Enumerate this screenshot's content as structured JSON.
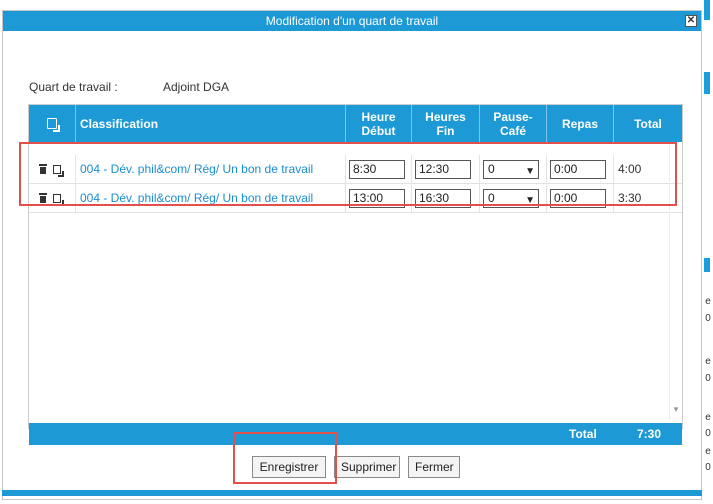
{
  "dialog": {
    "title": "Modification d'un quart de travail",
    "close_symbol": "✕"
  },
  "shift": {
    "label": "Quart de travail :",
    "value": "Adjoint DGA"
  },
  "table": {
    "headers": {
      "action_icon": "copy-icon",
      "classification": "Classification",
      "start": "Heure\nDébut",
      "end": "Heures\nFin",
      "coffee": "Pause-\nCafé",
      "meal": "Repas",
      "total": "Total"
    },
    "rows": [
      {
        "classification": "004 - Dév. phil&com/ Rég/ Un bon de travail",
        "start": "8:30",
        "end": "12:30",
        "coffee": "0",
        "meal": "0:00",
        "total": "4:00"
      },
      {
        "classification": "004 - Dév. phil&com/ Rég/ Un bon de travail",
        "start": "13:00",
        "end": "16:30",
        "coffee": "0",
        "meal": "0:00",
        "total": "3:30"
      }
    ],
    "footer": {
      "total_label": "Total",
      "total_value": "7:30"
    }
  },
  "buttons": {
    "save": "Enregistrer",
    "delete": "Supprimer",
    "close": "Fermer"
  },
  "background_fragments": [
    "e",
    "0",
    "e",
    "0",
    "e",
    "0",
    "e",
    "0",
    "e",
    "0"
  ],
  "colors": {
    "accent": "#1d9ad6",
    "link": "#1a8fd1",
    "highlight": "#e2504c"
  }
}
